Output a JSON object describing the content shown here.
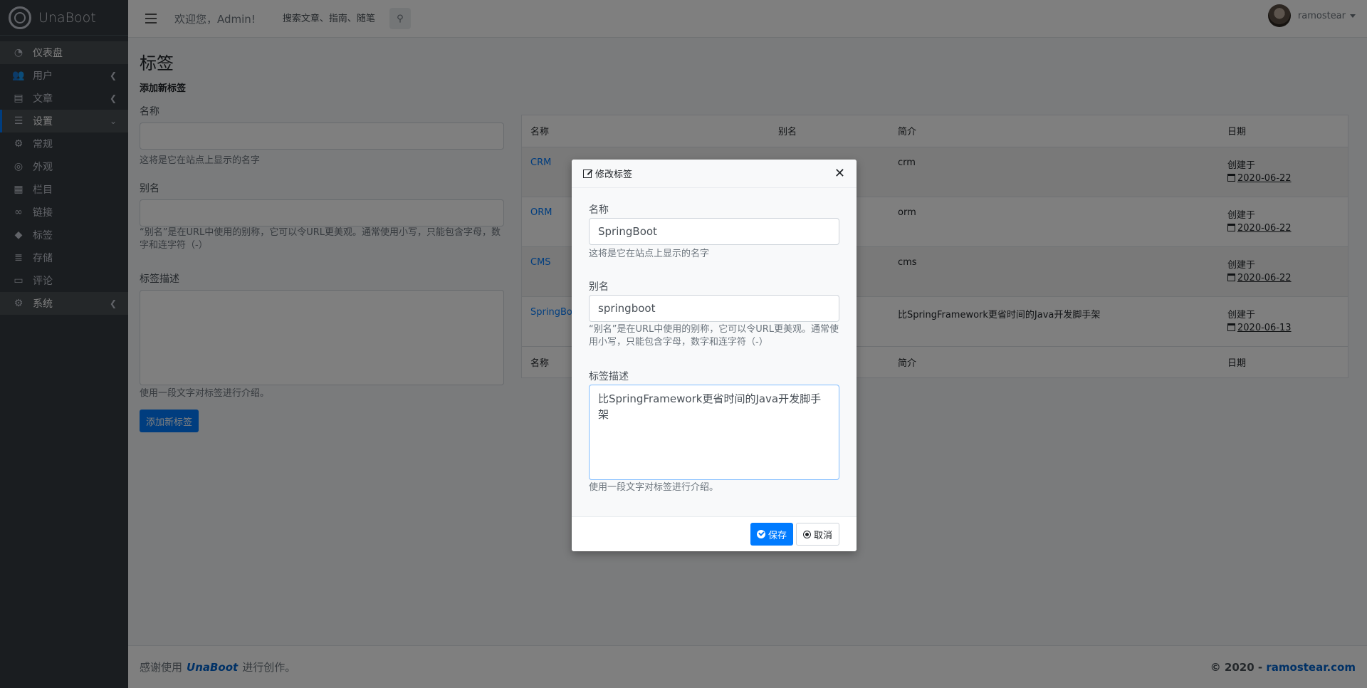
{
  "brand": {
    "name": "UnaBoot"
  },
  "sidebar": {
    "items": [
      {
        "label": "仪表盘",
        "icon": "tachometer-icon"
      },
      {
        "label": "用户",
        "icon": "users-icon"
      },
      {
        "label": "文章",
        "icon": "article-icon"
      },
      {
        "label": "设置",
        "icon": "sliders-icon"
      },
      {
        "label": "常规",
        "icon": "gear-icon"
      },
      {
        "label": "外观",
        "icon": "chrome-icon"
      },
      {
        "label": "栏目",
        "icon": "grid-icon"
      },
      {
        "label": "链接",
        "icon": "link-icon"
      },
      {
        "label": "标签",
        "icon": "tag-icon"
      },
      {
        "label": "存储",
        "icon": "storage-icon"
      },
      {
        "label": "评论",
        "icon": "comment-icon"
      },
      {
        "label": "系统",
        "icon": "cogs-icon"
      }
    ]
  },
  "topbar": {
    "welcome": "欢迎您，Admin!",
    "search_placeholder": "搜索文章、指南、随笔",
    "user_name": "ramostear"
  },
  "page": {
    "title": "标签",
    "subtitle": "添加新标签",
    "name_label": "名称",
    "name_help": "这将是它在站点上显示的名字",
    "alias_label": "别名",
    "alias_help": "“别名”是在URL中使用的别称，它可以令URL更美观。通常使用小写，只能包含字母，数字和连字符（-）",
    "desc_label": "标签描述",
    "desc_help": "使用一段文字对标签进行介绍。",
    "add_button": "添加新标签"
  },
  "table": {
    "headers": [
      "名称",
      "别名",
      "简介",
      "日期"
    ],
    "rows": [
      {
        "name": "CRM",
        "alias": "",
        "intro": "crm",
        "created": "创建于",
        "date": "2020-06-22"
      },
      {
        "name": "ORM",
        "alias": "",
        "intro": "orm",
        "created": "创建于",
        "date": "2020-06-22"
      },
      {
        "name": "CMS",
        "alias": "",
        "intro": "cms",
        "created": "创建于",
        "date": "2020-06-22"
      },
      {
        "name": "SpringBoot",
        "alias": "",
        "intro": "比SpringFramework更省时间的Java开发脚手架",
        "created": "创建于",
        "date": "2020-06-13"
      }
    ]
  },
  "modal": {
    "title": "修改标签",
    "name_label": "名称",
    "name_value": "SpringBoot",
    "name_help": "这将是它在站点上显示的名字",
    "alias_label": "别名",
    "alias_value": "springboot",
    "alias_help": "“别名”是在URL中使用的别称，它可以令URL更美观。通常使用小写，只能包含字母，数字和连字符（-）",
    "desc_label": "标签描述",
    "desc_value": "比SpringFramework更省时间的Java开发脚手架",
    "desc_help": "使用一段文字对标签进行介绍。",
    "save": "保存",
    "cancel": "取消"
  },
  "footer": {
    "left_prefix": "感谢使用",
    "brand": "UnaBoot",
    "left_suffix": "进行创作。",
    "copyright": "© 2020 -",
    "site": "ramostear.com"
  },
  "colors": {
    "primary": "#007bff",
    "sidebar": "#343a40"
  }
}
